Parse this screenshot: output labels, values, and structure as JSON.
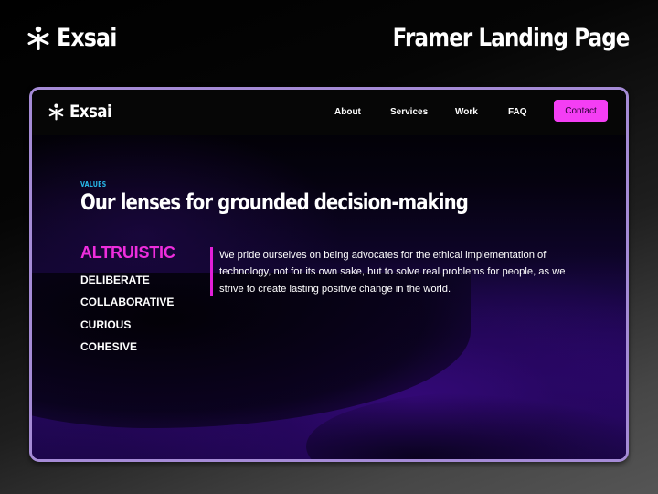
{
  "header": {
    "brand_name": "Exsai",
    "brand_icon": "asterisk-person-logo-icon",
    "page_label": "Framer Landing Page"
  },
  "site": {
    "nav": {
      "brand_name": "Exsai",
      "brand_icon": "asterisk-person-logo-icon",
      "links": [
        {
          "label": "About"
        },
        {
          "label": "Services"
        },
        {
          "label": "Work"
        },
        {
          "label": "FAQ"
        }
      ],
      "contact_label": "Contact"
    },
    "section": {
      "eyebrow": "VALUES",
      "heading": "Our lenses for grounded decision-making",
      "values": [
        {
          "label": "ALTRUISTIC",
          "active": true
        },
        {
          "label": "DELIBERATE",
          "active": false
        },
        {
          "label": "COLLABORATIVE",
          "active": false
        },
        {
          "label": "CURIOUS",
          "active": false
        },
        {
          "label": "COHESIVE",
          "active": false
        }
      ],
      "description": "We pride ourselves on being advocates for the ethical implementation of technology, not for its own sake, but to solve real problems for people, as we strive to create lasting positive change in the world."
    }
  },
  "colors": {
    "frame_border": "#a58bd6",
    "accent_pink": "#f43ef4",
    "active_value": "#ee2ddd",
    "eyebrow": "#27b5e6",
    "background_purple": "#2a0a6e"
  }
}
